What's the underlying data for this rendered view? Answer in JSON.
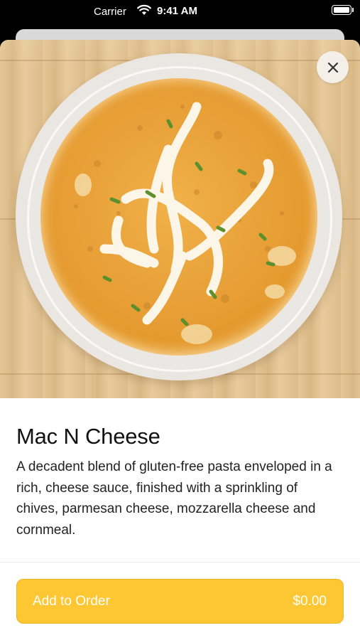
{
  "status_bar": {
    "carrier": "Carrier",
    "time": "9:41 AM",
    "wifi_icon": "wifi-icon",
    "battery_icon": "battery-icon"
  },
  "item": {
    "image_alt": "mac-n-cheese-photo",
    "title": "Mac N Cheese",
    "description": "A decadent blend of gluten-free pasta enveloped in a rich, cheese sauce, finished with a sprinkling of chives, parmesan cheese, mozzarella cheese and cornmeal."
  },
  "actions": {
    "close_icon": "close-icon",
    "add_label": "Add to Order",
    "price": "$0.00"
  },
  "colors": {
    "accent": "#fdc734",
    "accent_border": "#f1b31f",
    "text": "#111111"
  }
}
